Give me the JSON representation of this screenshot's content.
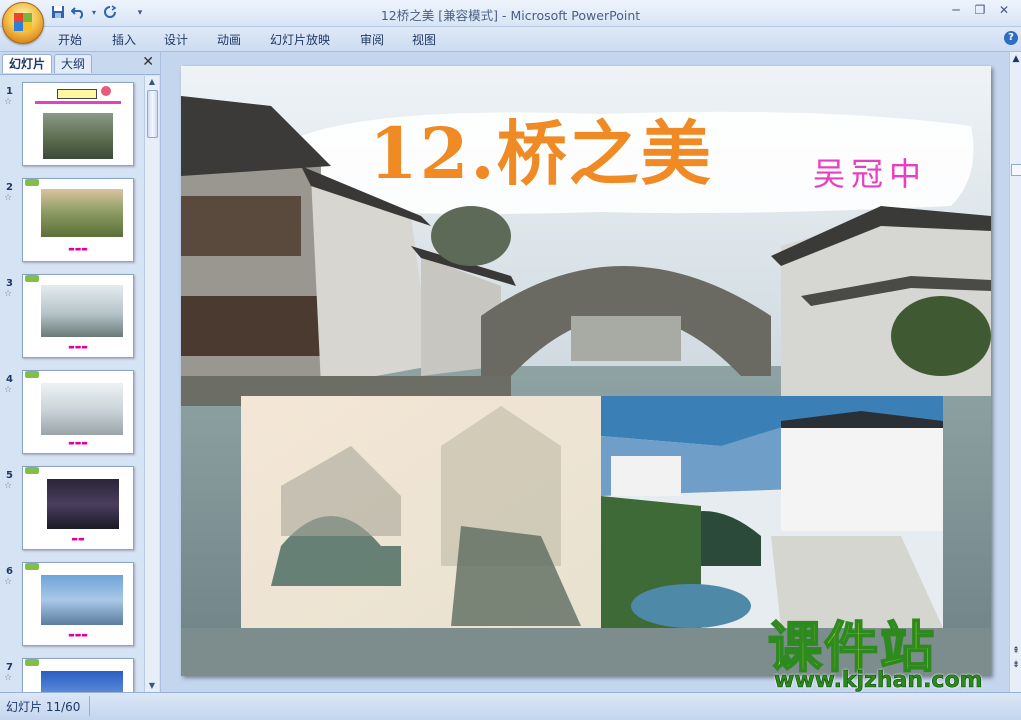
{
  "window": {
    "title": "12桥之美 [兼容模式] - Microsoft PowerPoint",
    "controls": [
      "minimize-icon",
      "restore-icon",
      "close-icon"
    ]
  },
  "quick_access": [
    "save-icon",
    "undo-icon",
    "redo-icon",
    "customize-icon"
  ],
  "ribbon_tabs": [
    "开始",
    "插入",
    "设计",
    "动画",
    "幻灯片放映",
    "审阅",
    "视图"
  ],
  "panel": {
    "tabs": [
      "幻灯片",
      "大纲"
    ],
    "active_tab": "幻灯片",
    "slides": [
      {
        "num": "1",
        "caption": ""
      },
      {
        "num": "2",
        "caption": ""
      },
      {
        "num": "3",
        "caption": ""
      },
      {
        "num": "4",
        "caption": ""
      },
      {
        "num": "5",
        "caption": ""
      },
      {
        "num": "6",
        "caption": ""
      },
      {
        "num": "7",
        "caption": ""
      }
    ]
  },
  "slide": {
    "title": "12.桥之美",
    "author": "吴冠中"
  },
  "status": {
    "slide_indicator": "幻灯片 11/60"
  },
  "watermark": {
    "title": "课件站",
    "url": "www.kjzhan.com"
  },
  "colors": {
    "title": "#f08a24",
    "author": "#e83ec0",
    "watermark_fill": "#d4e21a",
    "watermark_stroke": "#2d8a1e"
  }
}
